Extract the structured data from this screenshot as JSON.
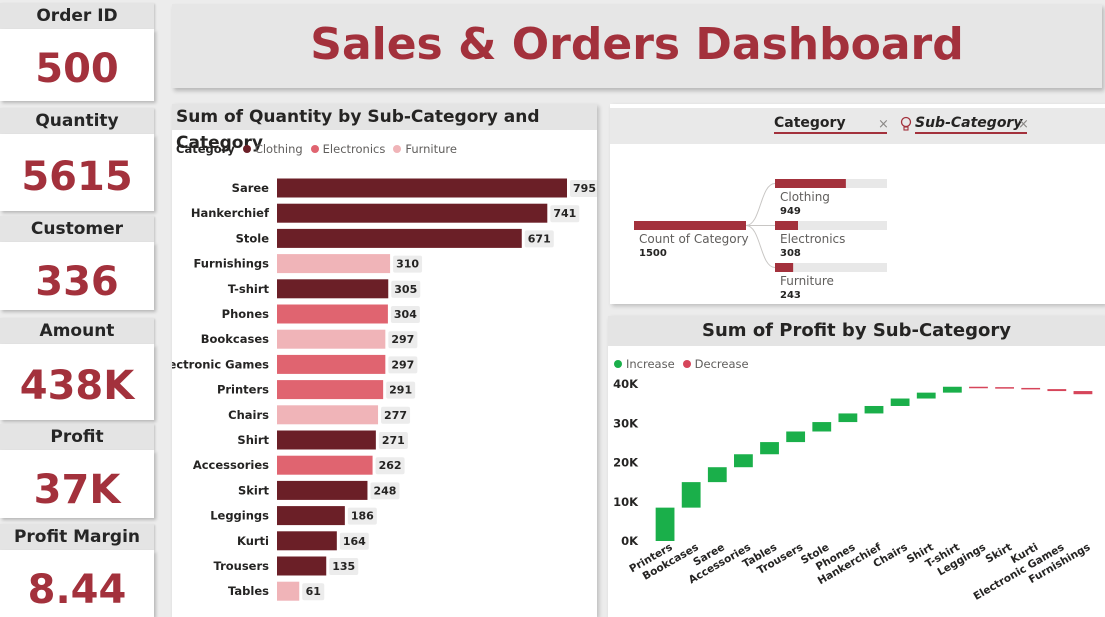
{
  "title": "Sales & Orders Dashboard",
  "kpis": [
    {
      "label": "Order ID",
      "value": "500"
    },
    {
      "label": "Quantity",
      "value": "5615"
    },
    {
      "label": "Customer",
      "value": "336"
    },
    {
      "label": "Amount",
      "value": "438K"
    },
    {
      "label": "Profit",
      "value": "37K"
    },
    {
      "label": "Profit Margin",
      "value": "8.44"
    }
  ],
  "colors": {
    "clothing": "#6b1f27",
    "electronics": "#e06470",
    "furniture": "#f0b4b8",
    "increase": "#1aaf4a",
    "decrease": "#d6455a",
    "accent": "#a3313c"
  },
  "quantity_panel": {
    "title": "Sum of Quantity by Sub-Category and Category",
    "legend_title": "Category",
    "legend_items": [
      "Clothing",
      "Electronics",
      "Furniture"
    ]
  },
  "decomp_panel": {
    "slicer1": "Category",
    "slicer2": "Sub-Category",
    "root_label": "Count of Category",
    "root_value": "1500",
    "nodes": [
      {
        "label": "Clothing",
        "value": "949"
      },
      {
        "label": "Electronics",
        "value": "308"
      },
      {
        "label": "Furniture",
        "value": "243"
      }
    ]
  },
  "profit_panel": {
    "title": "Sum of Profit by Sub-Category",
    "legend_items": [
      "Increase",
      "Decrease"
    ]
  },
  "chart_data": [
    {
      "type": "bar",
      "orientation": "horizontal",
      "title": "Sum of Quantity by Sub-Category and Category",
      "legend_title": "Category",
      "categories": [
        "Saree",
        "Hankerchief",
        "Stole",
        "Furnishings",
        "T-shirt",
        "Phones",
        "Bookcases",
        "Electronic Games",
        "Printers",
        "Chairs",
        "Shirt",
        "Accessories",
        "Skirt",
        "Leggings",
        "Kurti",
        "Trousers",
        "Tables"
      ],
      "values": [
        795,
        741,
        671,
        310,
        305,
        304,
        297,
        297,
        291,
        277,
        271,
        262,
        248,
        186,
        164,
        135,
        61
      ],
      "category_group": [
        "Clothing",
        "Clothing",
        "Clothing",
        "Furniture",
        "Clothing",
        "Electronics",
        "Furniture",
        "Electronics",
        "Electronics",
        "Furniture",
        "Clothing",
        "Electronics",
        "Clothing",
        "Clothing",
        "Clothing",
        "Clothing",
        "Furniture"
      ],
      "series": [
        {
          "name": "Clothing"
        },
        {
          "name": "Electronics"
        },
        {
          "name": "Furniture"
        }
      ]
    },
    {
      "type": "bar",
      "chart_type": "decomposition-tree",
      "categories": [
        "Clothing",
        "Electronics",
        "Furniture"
      ],
      "values": [
        949,
        308,
        243
      ],
      "total": 1500
    },
    {
      "type": "bar",
      "chart_type": "waterfall",
      "title": "Sum of Profit by Sub-Category",
      "categories": [
        "Printers",
        "Bookcases",
        "Saree",
        "Accessories",
        "Tables",
        "Trousers",
        "Stole",
        "Phones",
        "Hankerchief",
        "Chairs",
        "Shirt",
        "T-shirt",
        "Leggings",
        "Skirt",
        "Kurti",
        "Electronic Games",
        "Furnishings"
      ],
      "deltas": [
        8500,
        6500,
        3800,
        3300,
        3100,
        2700,
        2400,
        2200,
        1900,
        1900,
        1500,
        1500,
        100,
        200,
        300,
        500,
        800
      ],
      "direction": [
        "Increase",
        "Increase",
        "Increase",
        "Increase",
        "Increase",
        "Increase",
        "Increase",
        "Increase",
        "Increase",
        "Increase",
        "Increase",
        "Increase",
        "Decrease",
        "Decrease",
        "Decrease",
        "Decrease",
        "Decrease"
      ],
      "yticks": [
        "0K",
        "10K",
        "20K",
        "30K",
        "40K"
      ],
      "ylim": [
        0,
        40000
      ],
      "series": [
        {
          "name": "Increase"
        },
        {
          "name": "Decrease"
        }
      ]
    }
  ]
}
